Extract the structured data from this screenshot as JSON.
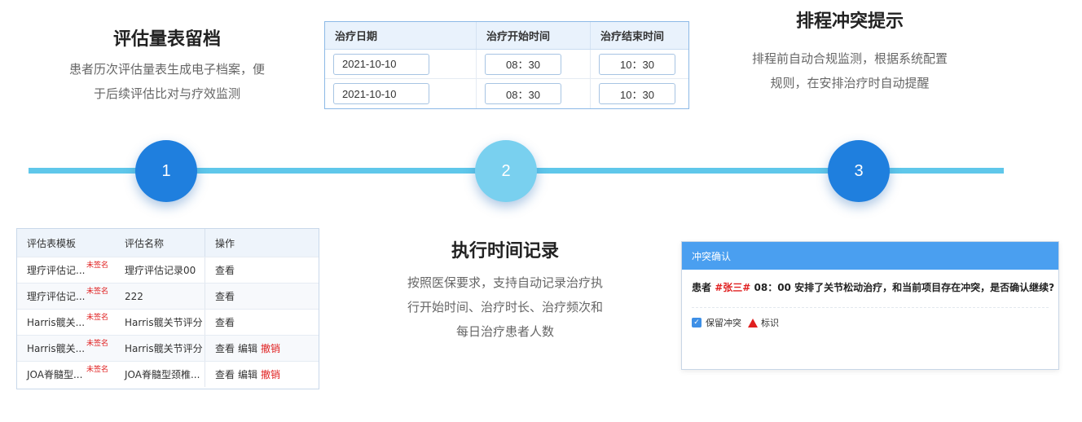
{
  "features": {
    "eval_archive": {
      "title": "评估量表留档",
      "desc_line1": "患者历次评估量表生成电子档案，便",
      "desc_line2": "于后续评估比对与疗效监测"
    },
    "exec_record": {
      "title": "执行时间记录",
      "desc_line1": "按照医保要求，支持自动记录治疗执",
      "desc_line2": "行开始时间、治疗时长、治疗频次和",
      "desc_line3": "每日治疗患者人数"
    },
    "conflict_alert": {
      "title": "排程冲突提示",
      "desc_line1": "排程前自动合规监测，根据系统配置",
      "desc_line2": "规则，在安排治疗时自动提醒"
    }
  },
  "timeline": {
    "steps": [
      "1",
      "2",
      "3"
    ],
    "line_color": "#5fc7ea",
    "dark_color": "#1f7fde",
    "light_color": "#79d0ef"
  },
  "schedule_table": {
    "headers": [
      "治疗日期",
      "治疗开始时间",
      "治疗结束时间"
    ],
    "rows": [
      {
        "date": "2021-10-10",
        "start": "08：30",
        "end": "10：30"
      },
      {
        "date": "2021-10-10",
        "start": "08：30",
        "end": "10：30"
      }
    ]
  },
  "eval_table": {
    "headers": [
      "评估表模板",
      "评估名称",
      "操作"
    ],
    "unsigned_label": "未签名",
    "rows": [
      {
        "template": "理疗评估记...",
        "name": "理疗评估记录00",
        "actions": [
          "查看"
        ],
        "revoke": ""
      },
      {
        "template": "理疗评估记...",
        "name": "222",
        "actions": [
          "查看"
        ],
        "revoke": ""
      },
      {
        "template": "Harris髋关...",
        "name": "Harris髋关节评分",
        "actions": [
          "查看"
        ],
        "revoke": ""
      },
      {
        "template": "Harris髋关...",
        "name": "Harris髋关节评分",
        "actions": [
          "查看",
          "编辑"
        ],
        "revoke": "撤销"
      },
      {
        "template": "JOA脊髓型...",
        "name": "JOA脊髓型颈椎...",
        "actions": [
          "查看",
          "编辑"
        ],
        "revoke": "撤销"
      }
    ]
  },
  "conflict_dialog": {
    "title": "冲突确认",
    "msg_prefix": "患者 ",
    "patient": "#张三#",
    "msg_body": " 08：00 安排了关节松动治疗，和当前项目存在冲突，是否确认继续?",
    "keep_label": "保留冲突",
    "mark_label": "标识"
  }
}
